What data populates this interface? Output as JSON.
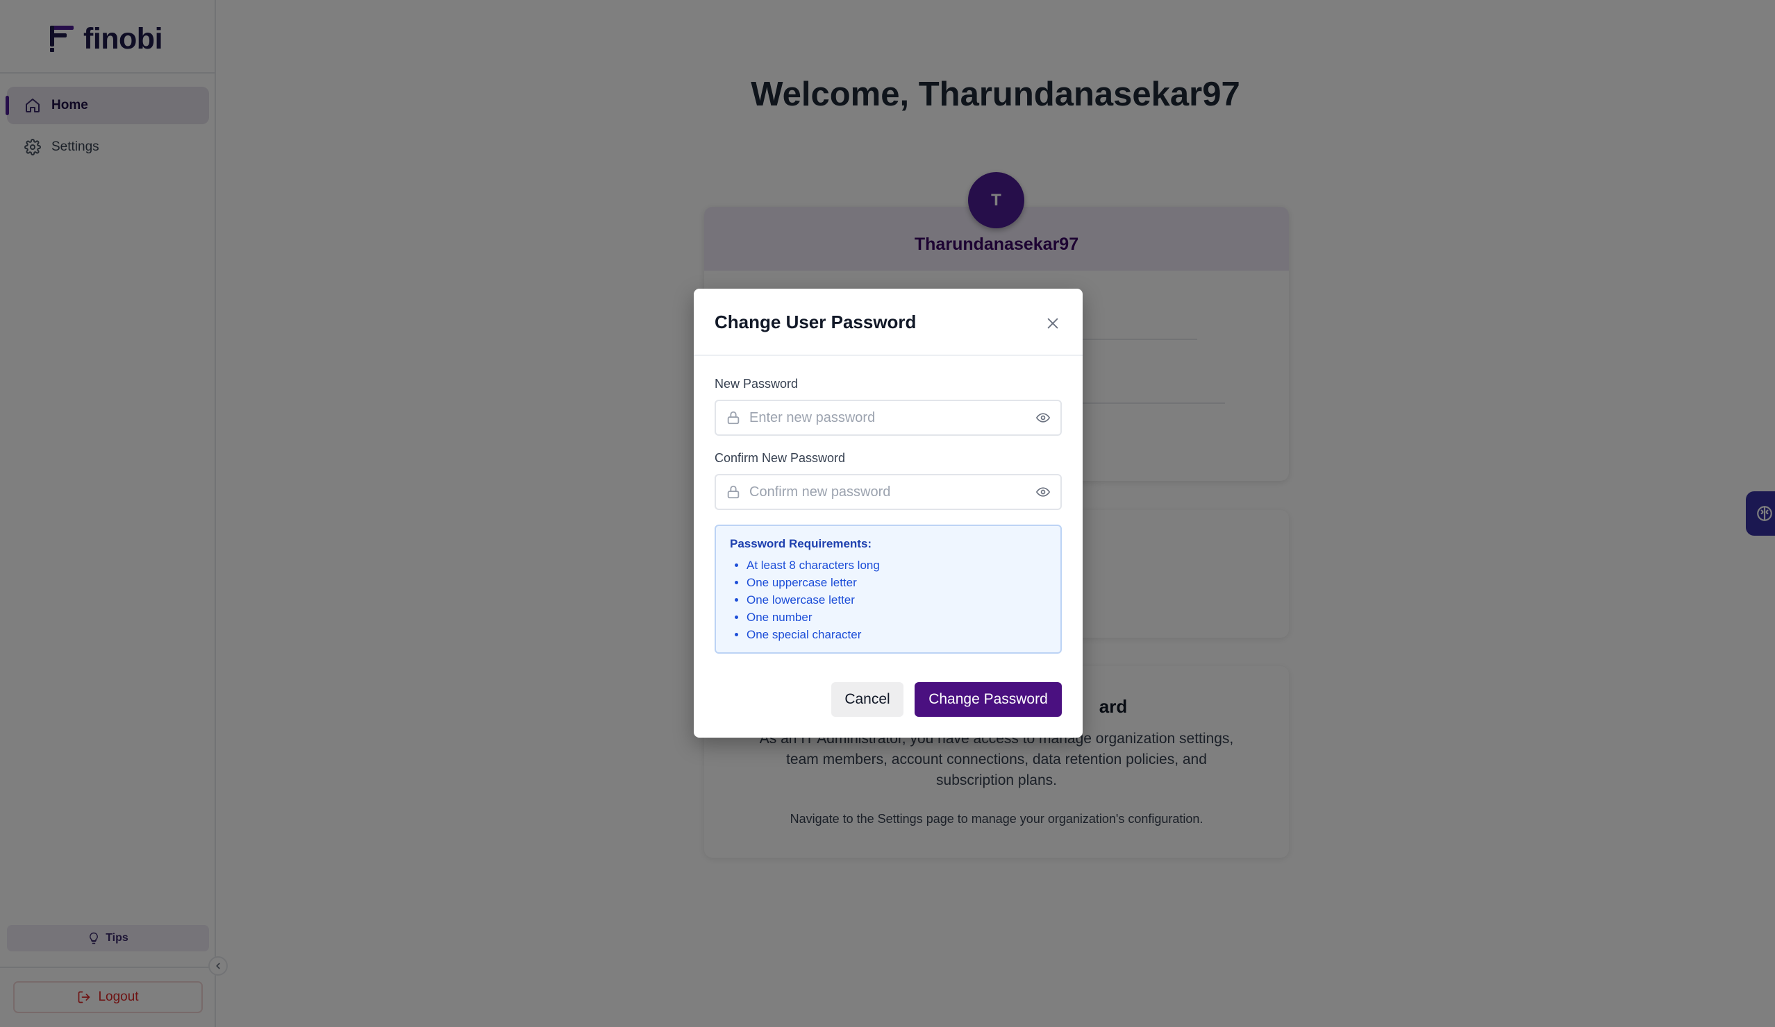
{
  "app": {
    "brand": "finobi",
    "brand_color": "#4c1d95"
  },
  "sidebar": {
    "items": [
      {
        "label": "Home",
        "icon": "home-icon",
        "active": true
      },
      {
        "label": "Settings",
        "icon": "gear-icon",
        "active": false
      }
    ],
    "tips_label": "Tips",
    "logout_label": "Logout"
  },
  "main": {
    "welcome": "Welcome, Tharundanasekar97",
    "profile": {
      "avatar_initial": "T",
      "username": "Tharundanasekar97"
    },
    "dashboard_card": {
      "title_visible_fragment": "ard",
      "body": "As an IT Administrator, you have access to manage organization settings, team members, account connections, data retention policies, and subscription plans.",
      "nav_hint": "Navigate to the Settings page to manage your organization's configuration."
    }
  },
  "modal": {
    "title": "Change User Password",
    "new_password": {
      "label": "New Password",
      "placeholder": "Enter new password",
      "value": ""
    },
    "confirm_password": {
      "label": "Confirm New Password",
      "placeholder": "Confirm new password",
      "value": ""
    },
    "requirements": {
      "title": "Password Requirements:",
      "items": [
        "At least 8 characters long",
        "One uppercase letter",
        "One lowercase letter",
        "One number",
        "One special character"
      ]
    },
    "cancel_label": "Cancel",
    "submit_label": "Change Password"
  }
}
